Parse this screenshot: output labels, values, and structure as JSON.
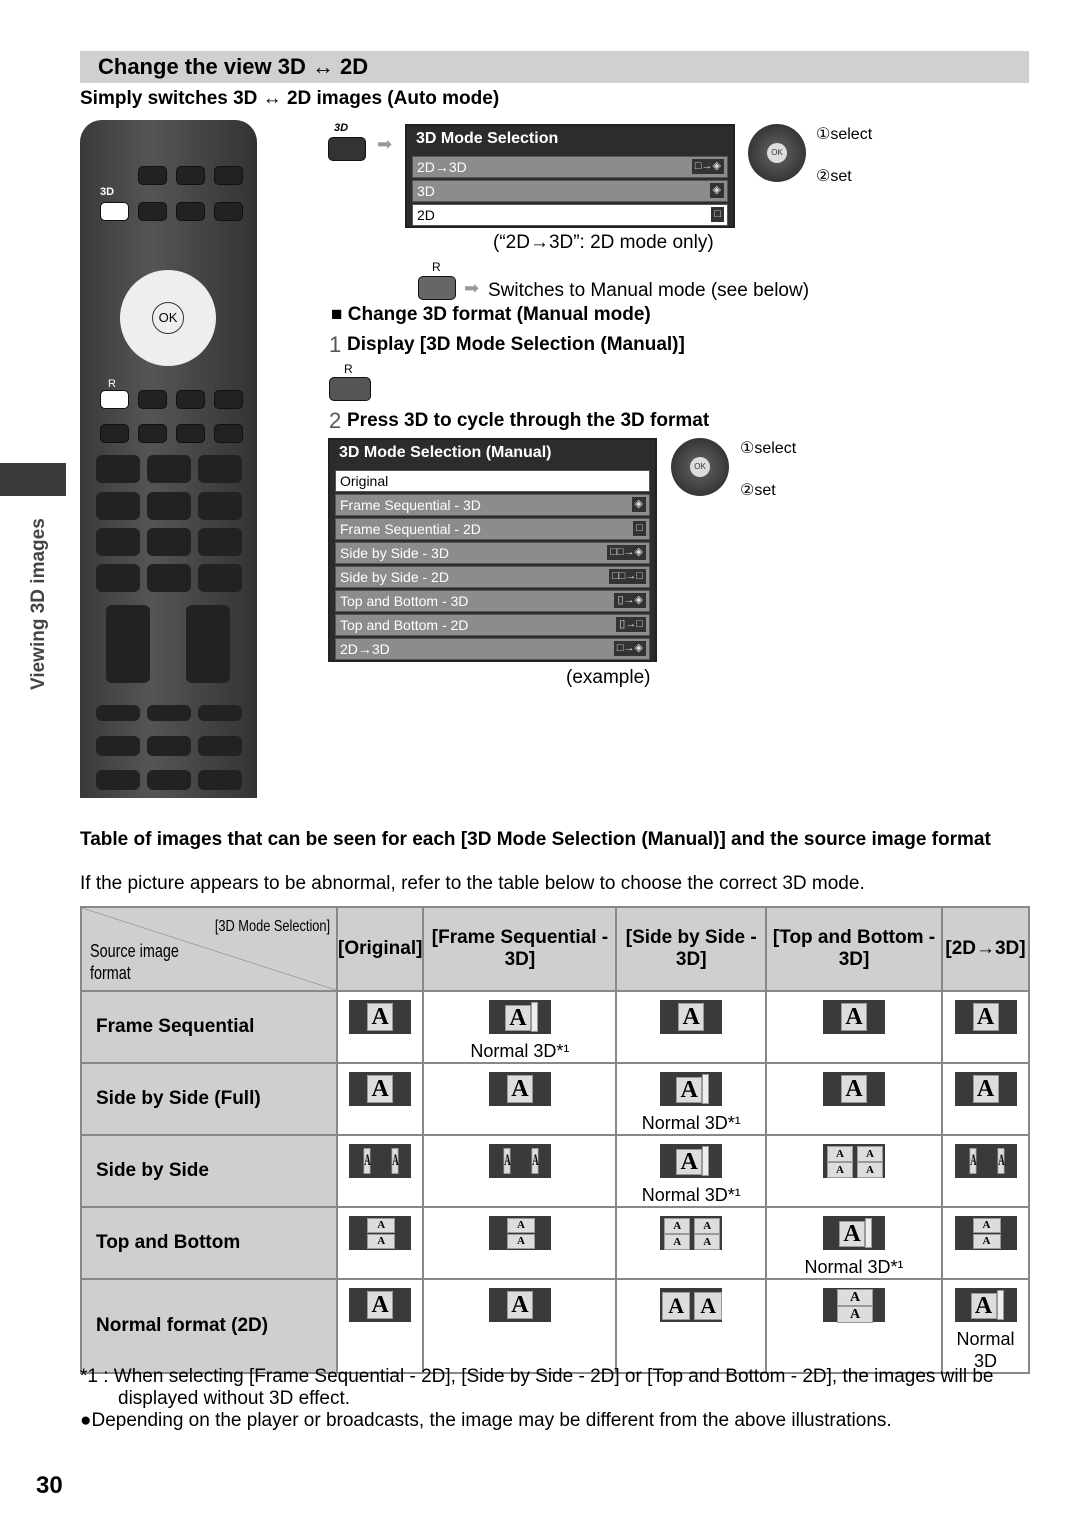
{
  "section_title": "Change the view 3D ↔ 2D",
  "auto_heading": "Simply switches 3D ↔ 2D images (Auto mode)",
  "side_tab": "Viewing 3D images",
  "remote": {
    "btn_3d_label": "3D",
    "btn_r_label": "R",
    "ok_label": "OK"
  },
  "auto_menu": {
    "title": "3D Mode Selection",
    "items": [
      {
        "label": "2D→3D",
        "icon": "□→◈"
      },
      {
        "label": "3D",
        "icon": "◈"
      },
      {
        "label": "2D",
        "icon": "□",
        "selected": true
      }
    ],
    "note": "(“2D→3D”: 2D mode only)"
  },
  "nav_hint": {
    "select": "①select",
    "set": "②set",
    "ok": "OK"
  },
  "r_button": {
    "label": "R",
    "text": "Switches to Manual mode (see below)"
  },
  "manual": {
    "heading": "■ Change 3D format (Manual mode)",
    "step1_num": "1",
    "step1": "Display [3D Mode Selection (Manual)]",
    "step1_btn": "R",
    "step2_num": "2",
    "step2": "Press 3D to cycle through the 3D format",
    "menu": {
      "title": "3D Mode Selection (Manual)",
      "items": [
        {
          "label": "Original",
          "icon": "",
          "selected": true
        },
        {
          "label": "Frame Sequential - 3D",
          "icon": "◈"
        },
        {
          "label": "Frame Sequential - 2D",
          "icon": "□"
        },
        {
          "label": "Side by Side - 3D",
          "icon": "□□→◈"
        },
        {
          "label": "Side by Side - 2D",
          "icon": "□□→□"
        },
        {
          "label": "Top and Bottom - 3D",
          "icon": "▯→◈"
        },
        {
          "label": "Top and Bottom - 2D",
          "icon": "▯→□"
        },
        {
          "label": "2D→3D",
          "icon": "□→◈"
        }
      ]
    },
    "note": "(example)"
  },
  "table_section": {
    "heading": "Table of images that can be seen for each [3D Mode Selection (Manual)] and the source image format",
    "intro": "If the picture appears to be abnormal, refer to the table below to choose the correct 3D mode."
  },
  "table": {
    "corner_top": "[3D Mode Selection]",
    "corner_bottom": "Source image format",
    "columns": [
      "[Original]",
      "[Frame Sequential - 3D]",
      "[Side by Side - 3D]",
      "[Top and Bottom - 3D]",
      "[2D→3D]"
    ],
    "rows": [
      {
        "label": "Frame Sequential",
        "cells": [
          {
            "icon": "single"
          },
          {
            "icon": "single-3d",
            "caption": "Normal 3D*¹"
          },
          {
            "icon": "single"
          },
          {
            "icon": "single"
          },
          {
            "icon": "single"
          }
        ]
      },
      {
        "label": "Side by Side (Full)",
        "cells": [
          {
            "icon": "single"
          },
          {
            "icon": "single"
          },
          {
            "icon": "single-3d",
            "caption": "Normal 3D*¹"
          },
          {
            "icon": "single"
          },
          {
            "icon": "single"
          }
        ]
      },
      {
        "label": "Side by Side",
        "cells": [
          {
            "icon": "side-by-side"
          },
          {
            "icon": "side-by-side"
          },
          {
            "icon": "single-3d",
            "caption": "Normal 3D*¹"
          },
          {
            "icon": "quad"
          },
          {
            "icon": "side-by-side"
          }
        ]
      },
      {
        "label": "Top and Bottom",
        "cells": [
          {
            "icon": "top-bottom"
          },
          {
            "icon": "top-bottom"
          },
          {
            "icon": "quad"
          },
          {
            "icon": "single-3d",
            "caption": "Normal 3D*¹"
          },
          {
            "icon": "top-bottom"
          }
        ]
      },
      {
        "label": "Normal format (2D)",
        "cells": [
          {
            "icon": "single"
          },
          {
            "icon": "single"
          },
          {
            "icon": "half-split"
          },
          {
            "icon": "half-stack"
          },
          {
            "icon": "single-3d",
            "caption": "Normal 3D"
          }
        ]
      }
    ]
  },
  "footnote": "*1 : When selecting [Frame Sequential - 2D], [Side by Side - 2D] or [Top and Bottom - 2D], the images will be displayed without 3D effect.",
  "bullet": "●Depending on the player or broadcasts, the image may be different from the above illustrations.",
  "page_number": "30"
}
